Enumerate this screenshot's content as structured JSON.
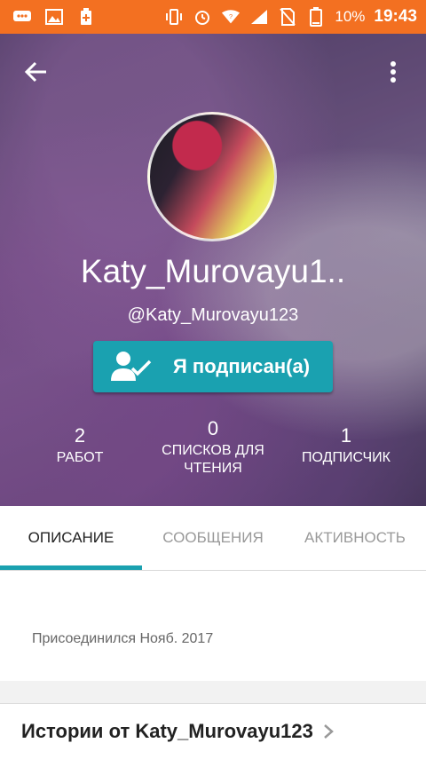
{
  "status_bar": {
    "battery": "10%",
    "time": "19:43",
    "colors": {
      "background": "#f37021"
    }
  },
  "profile": {
    "display_name": "Katy_Murovayu1..",
    "username": "@Katy_Murovayu123",
    "follow_button_label": "Я подписан(а)",
    "stats": [
      {
        "value": "2",
        "label": "РАБОТ"
      },
      {
        "value": "0",
        "label": "СПИСКОВ ДЛЯ ЧТЕНИЯ"
      },
      {
        "value": "1",
        "label": "ПОДПИСЧИК"
      }
    ]
  },
  "tabs": [
    {
      "label": "ОПИСАНИЕ",
      "active": true
    },
    {
      "label": "СООБЩЕНИЯ",
      "active": false
    },
    {
      "label": "АКТИВНОСТЬ",
      "active": false
    }
  ],
  "about": {
    "joined_text": "Присоединился Нояб. 2017"
  },
  "stories": {
    "title": "Истории от Katy_Murovayu123"
  },
  "icons": {
    "back": "arrow-left-icon",
    "menu": "more-vertical-icon",
    "follow": "user-check-icon",
    "stories_chevron": "chevron-right-icon"
  },
  "colors": {
    "accent": "#1aa1b0"
  }
}
